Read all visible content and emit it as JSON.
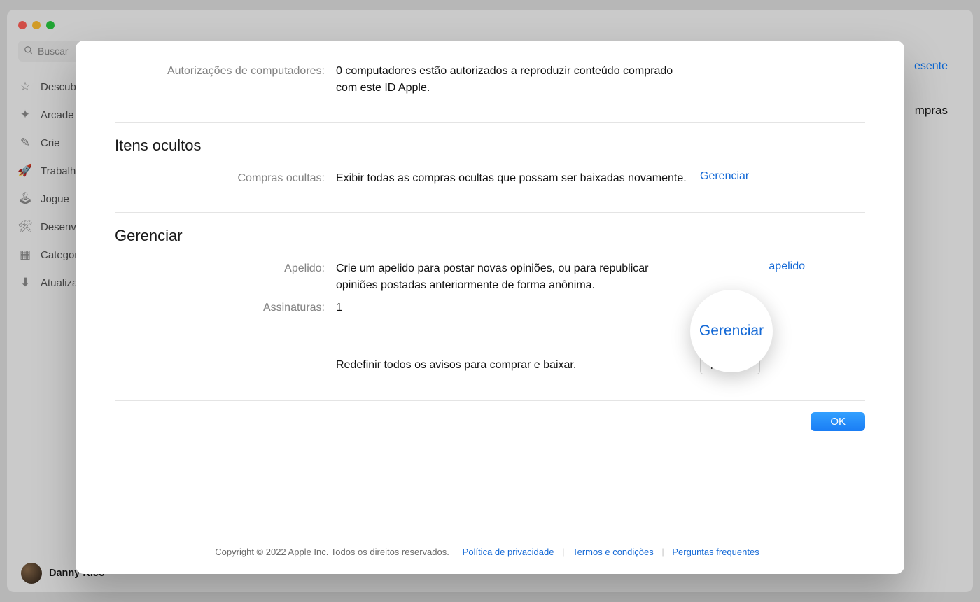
{
  "window": {
    "search_placeholder": "Buscar",
    "sidebar": {
      "items": [
        {
          "icon": "☆",
          "label": "Descubra"
        },
        {
          "icon": "✦",
          "label": "Arcade"
        },
        {
          "icon": "✎",
          "label": "Crie"
        },
        {
          "icon": "🚀",
          "label": "Trabalhe"
        },
        {
          "icon": "🕹",
          "label": "Jogue"
        },
        {
          "icon": "🛠",
          "label": "Desenvolva"
        },
        {
          "icon": "▦",
          "label": "Categorias"
        },
        {
          "icon": "⬇",
          "label": "Atualizações"
        }
      ]
    },
    "user_name": "Danny Rico",
    "top_right_link": "esente",
    "top_right_heading": "mpras"
  },
  "modal": {
    "section1": {
      "label1": "Autorizações de computadores:",
      "value1": "0 computadores estão autorizados a reproduzir conteúdo comprado com este ID Apple."
    },
    "section2": {
      "title": "Itens ocultos",
      "label1": "Compras ocultas:",
      "value1": "Exibir todas as compras ocultas que possam ser baixadas novamente.",
      "action1": "Gerenciar"
    },
    "section3": {
      "title": "Gerenciar",
      "label1": "Apelido:",
      "value1": "Crie um apelido para postar novas opiniões, ou para republicar opiniões postadas anteriormente de forma anônima.",
      "action1_partial": "apelido",
      "label2": "Assinaturas:",
      "value2": "1",
      "action2": "Gerenciar"
    },
    "section4": {
      "value1": "Redefinir todos os avisos para comprar e baixar.",
      "button": "Redefinir"
    },
    "ok_label": "OK",
    "footer": {
      "copyright": "Copyright © 2022 Apple Inc. Todos os direitos reservados.",
      "link1": "Política de privacidade",
      "link2": "Termos e condições",
      "link3": "Perguntas frequentes"
    },
    "magnifier_text": "Gerenciar"
  }
}
